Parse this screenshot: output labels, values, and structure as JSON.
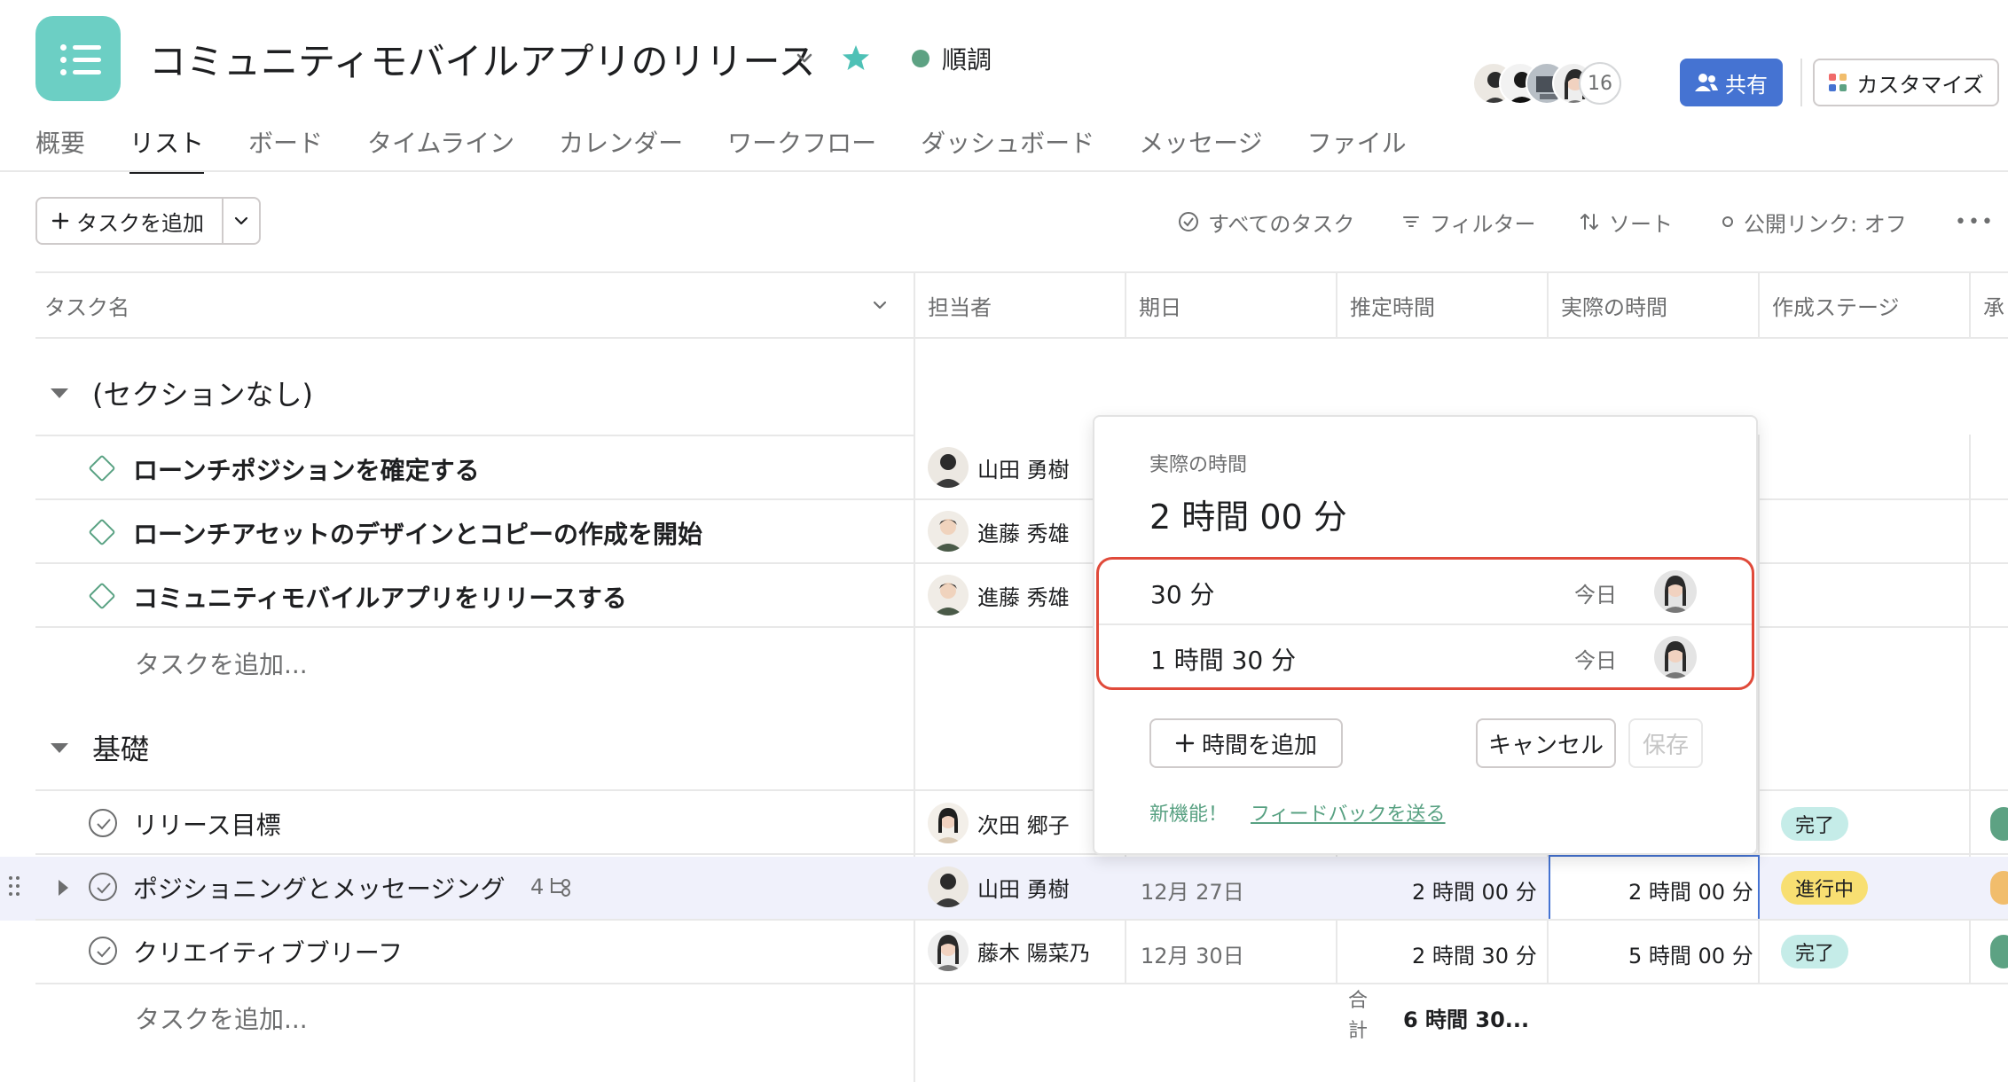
{
  "project": {
    "title": "コミュニティモバイルアプリのリリース",
    "status": "順調",
    "member_count": "16",
    "share_label": "共有",
    "customize_label": "カスタマイズ",
    "brand_color": "#6ccfc4",
    "status_color": "#5da283"
  },
  "tabs": [
    {
      "label": "概要"
    },
    {
      "label": "リスト"
    },
    {
      "label": "ボード"
    },
    {
      "label": "タイムライン"
    },
    {
      "label": "カレンダー"
    },
    {
      "label": "ワークフロー"
    },
    {
      "label": "ダッシュボード"
    },
    {
      "label": "メッセージ"
    },
    {
      "label": "ファイル"
    }
  ],
  "active_tab": "リスト",
  "toolbar": {
    "add_task": "タスクを追加",
    "all_tasks": "すべてのタスク",
    "filter": "フィルター",
    "sort": "ソート",
    "public_link": "公開リンク: オフ",
    "more": "•••"
  },
  "columns": {
    "task_name": "タスク名",
    "assignee": "担当者",
    "due_date": "期日",
    "estimated": "推定時間",
    "actual": "実際の時間",
    "stage": "作成ステージ",
    "approval": "承"
  },
  "sections": [
    {
      "title": "(セクションなし)",
      "tasks": [
        {
          "name": "ローンチポジションを確定する",
          "assignee": "山田 勇樹"
        },
        {
          "name": "ローンチアセットのデザインとコピーの作成を開始",
          "assignee": "進藤 秀雄"
        },
        {
          "name": "コミュニティモバイルアプリをリリースする",
          "assignee": "進藤 秀雄"
        }
      ],
      "add_task": "タスクを追加..."
    },
    {
      "title": "基礎",
      "tasks": [
        {
          "name": "リリース目標",
          "assignee": "次田 郷子",
          "stage": "完了"
        },
        {
          "name": "ポジショニングとメッセージング",
          "subtask_count": "4",
          "assignee": "山田 勇樹",
          "due": "12月 27日",
          "estimated": "2 時間 00 分",
          "actual": "2 時間 00 分",
          "stage": "進行中"
        },
        {
          "name": "クリエイティブブリーフ",
          "assignee": "藤木 陽菜乃",
          "due": "12月 30日",
          "estimated": "2 時間 30 分",
          "actual": "5 時間 00 分",
          "stage": "完了"
        }
      ],
      "add_task": "タスクを追加...",
      "total_label": "合計",
      "total_value": "6 時間 30..."
    }
  ],
  "popup": {
    "label": "実際の時間",
    "total": "2 時間 00 分",
    "entries": [
      {
        "duration": "30 分",
        "date": "今日"
      },
      {
        "duration": "1 時間 30 分",
        "date": "今日"
      }
    ],
    "add_time": "時間を追加",
    "cancel": "キャンセル",
    "save": "保存",
    "new_feature": "新機能！",
    "feedback": "フィードバックを送る"
  },
  "colors": {
    "done_pill": "#c5ece8",
    "in_progress_pill": "#f8df72",
    "share_button": "#4573d2",
    "highlight_box": "#e04a3a"
  }
}
